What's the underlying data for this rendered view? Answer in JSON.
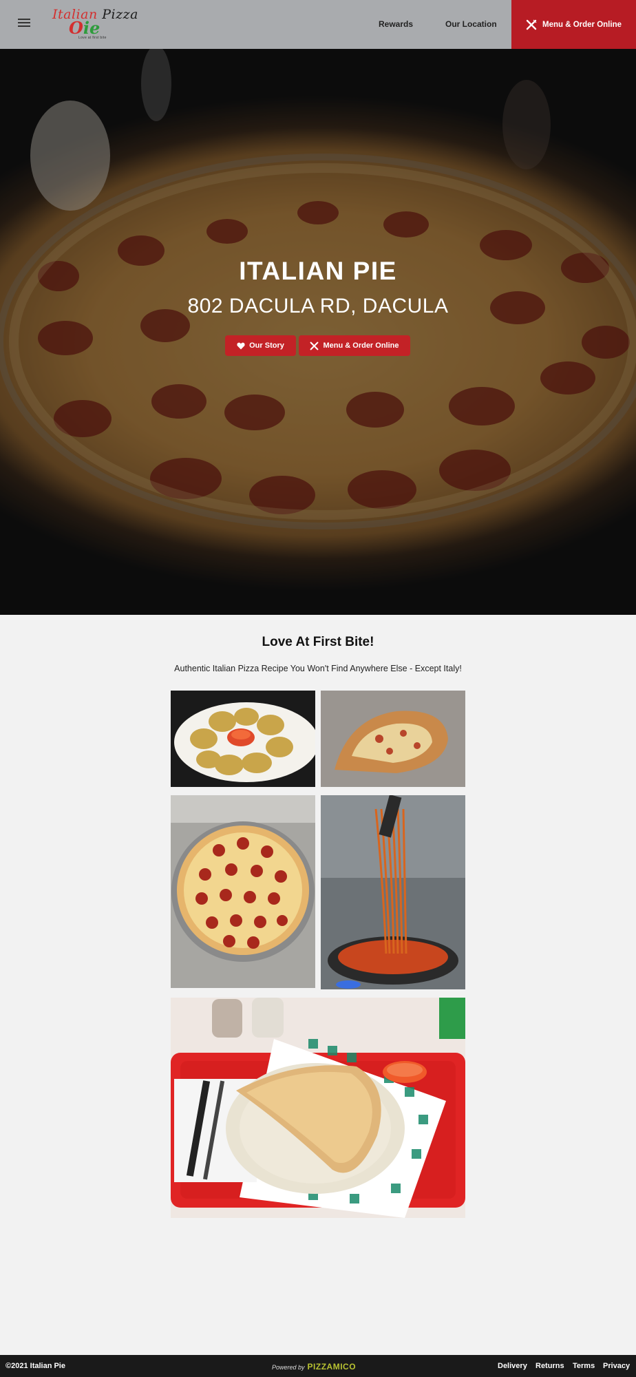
{
  "header": {
    "logo_line1_a": "Italian ",
    "logo_line1_b": "Pizza",
    "logo_line2_a": "P",
    "logo_line2_b": "ie",
    "logo_tagline": "Love at first bite",
    "nav": {
      "rewards": "Rewards",
      "location": "Our Location"
    },
    "order_label": "Menu & Order Online"
  },
  "hero": {
    "title": "ITALIAN PIE",
    "address": "802 DACULA RD, DACULA",
    "story_btn": "Our Story",
    "order_btn": "Menu & Order Online"
  },
  "main": {
    "title": "Love At First Bite!",
    "subtitle": "Authentic Italian Pizza Recipe You Won't Find Anywhere Else - Except Italy!"
  },
  "footer": {
    "copyright": "©2021 Italian Pie",
    "powered_by": "Powered by",
    "brand": "PIZZAMICO",
    "links": {
      "delivery": "Delivery",
      "returns": "Returns",
      "terms": "Terms",
      "privacy": "Privacy"
    }
  },
  "colors": {
    "accent": "#b71c24",
    "header_bg": "#a9abae",
    "footer_bg": "#1a1a1a",
    "brand": "#b8c232"
  },
  "icons": [
    "menu-icon",
    "fork-knife-icon",
    "heart-icon"
  ]
}
